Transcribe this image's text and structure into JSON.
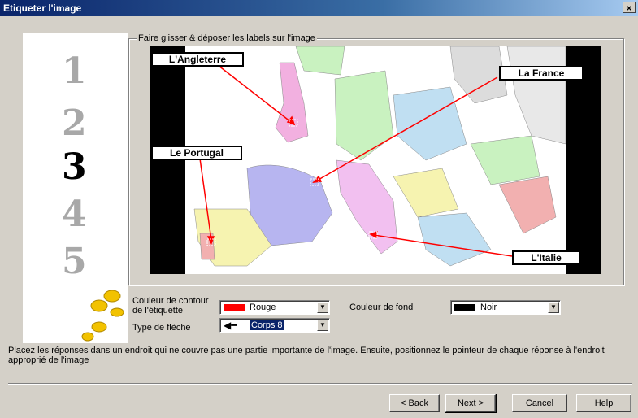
{
  "window": {
    "title": "Etiqueter l'image",
    "close": "×"
  },
  "steps": [
    "1",
    "2",
    "3",
    "4",
    "5"
  ],
  "active_step": 3,
  "group_label": "Faire glisser & déposer les labels sur l'image",
  "map_labels": {
    "angleterre": "L'Angleterre",
    "france": "La France",
    "portugal": "Le Portugal",
    "italie": "L'Italie"
  },
  "form": {
    "outline_color_label": "Couleur de contour de l'étiquette",
    "outline_color_value": "Rouge",
    "outline_color_hex": "#ff0000",
    "bg_color_label": "Couleur de fond",
    "bg_color_value": "Noir",
    "bg_color_hex": "#000000",
    "arrow_type_label": "Type de flèche",
    "arrow_type_value": "Corps 8"
  },
  "instructions": "Placez les réponses dans un endroit qui ne couvre pas une partie importante de l'image. Ensuite, positionnez le pointeur de chaque réponse à l'endroit approprié de l'image",
  "buttons": {
    "back": "< Back",
    "next": "Next >",
    "cancel": "Cancel",
    "help": "Help"
  }
}
